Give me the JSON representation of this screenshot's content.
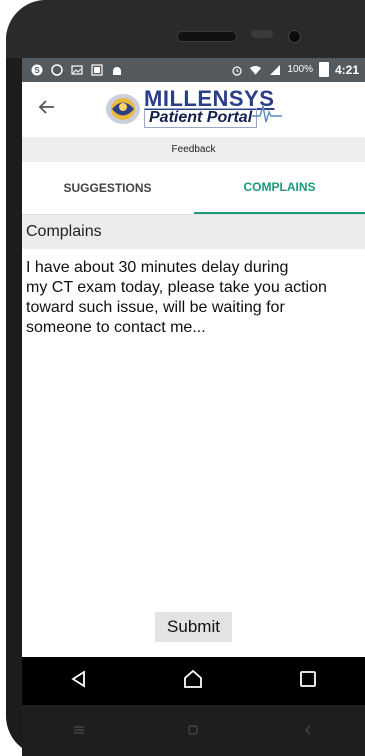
{
  "status_bar": {
    "battery_percent": "100%",
    "time": "4:21"
  },
  "app_bar": {
    "logo_title": "MILLENSYS",
    "logo_subtitle": "Patient Portal"
  },
  "page": {
    "subtitle": "Feedback"
  },
  "tabs": [
    {
      "label": "SUGGESTIONS",
      "selected": false
    },
    {
      "label": "COMPLAINS",
      "selected": true
    }
  ],
  "form": {
    "section_label": "Complains",
    "message": "I have about 30 minutes delay during\nmy CT exam today, please take you action\ntoward such issue, will be waiting for\n someone to contact me...",
    "submit_label": "Submit"
  },
  "colors": {
    "accent": "#1b9a7f",
    "status_bar": "#555a5f",
    "brand": "#2a3f86"
  },
  "icons": {
    "back": "arrow-left-icon",
    "nav_back": "triangle-back-icon",
    "nav_home": "home-icon",
    "nav_recents": "square-recents-icon"
  }
}
